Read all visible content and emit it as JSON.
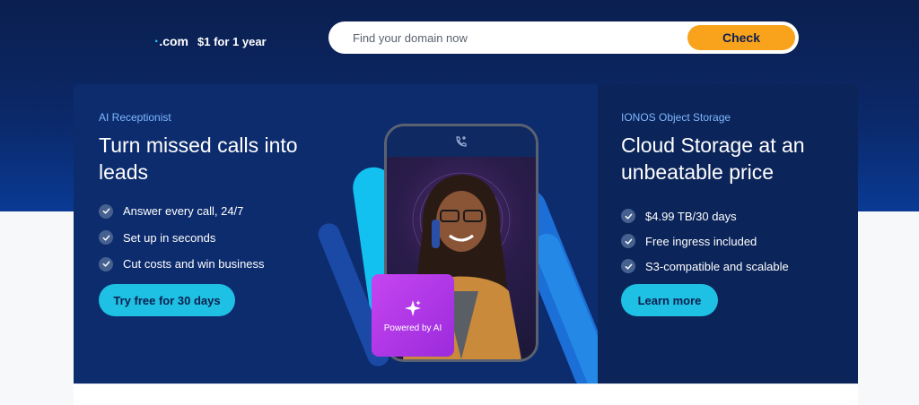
{
  "domain_promo": {
    "tld": ".com",
    "price_text": "$1 for 1 year"
  },
  "search": {
    "placeholder": "Find your domain now",
    "button_label": "Check"
  },
  "card_left": {
    "eyebrow": "AI Receptionist",
    "headline": "Turn missed calls into leads",
    "features": [
      "Answer every call, 24/7",
      "Set up in seconds",
      "Cut costs and win business"
    ],
    "cta_label": "Try free for 30 days",
    "badge_label": "Powered by AI"
  },
  "card_right": {
    "eyebrow": "IONOS Object Storage",
    "headline": "Cloud Storage at an unbeatable price",
    "features": [
      "$4.99 TB/30 days",
      "Free ingress included",
      "S3-compatible and scalable"
    ],
    "cta_label": "Learn more"
  },
  "colors": {
    "accent_cyan": "#1ec0e3",
    "check_orange": "#f9a21b",
    "ai_purple": "#b83be8",
    "navy": "#0b1f4f"
  }
}
